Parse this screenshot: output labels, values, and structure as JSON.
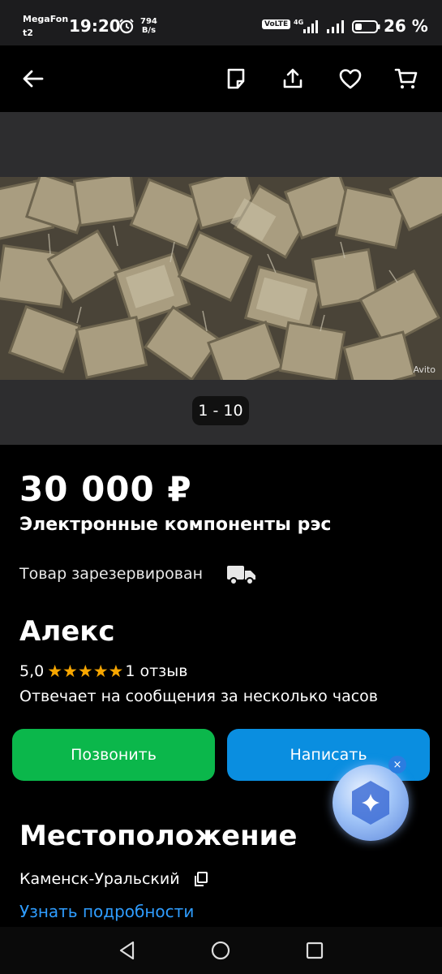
{
  "status_bar": {
    "carrier_top": "MegaFon",
    "carrier_bottom": "t2",
    "time": "19:20",
    "speed_value": "794",
    "speed_unit": "B/s",
    "volte": "VoLTE",
    "battery": "26 %"
  },
  "gallery": {
    "counter": "1 - 10",
    "watermark": "Avito"
  },
  "listing": {
    "price": "30 000 ₽",
    "title": "Электронные компоненты рэс",
    "status": "Товар зарезервирован"
  },
  "seller": {
    "name": "Алекс",
    "rating": "5,0",
    "stars": 5,
    "reviews": "1 отзыв",
    "response_time": "Отвечает на сообщения за несколько часов"
  },
  "actions": {
    "call_label": "Позвонить",
    "write_label": "Написать"
  },
  "location": {
    "heading": "Местоположение",
    "city": "Каменск-Уральский",
    "details_link": "Узнать подробности"
  },
  "colors": {
    "call_button": "#0bb74b",
    "write_button": "#0a8ee0",
    "star": "#f7a600",
    "link": "#2f9dff"
  },
  "icons": [
    "back-arrow-icon",
    "note-icon",
    "share-icon",
    "heart-icon",
    "cart-icon",
    "truck-icon",
    "copy-icon",
    "assistant-icon"
  ]
}
